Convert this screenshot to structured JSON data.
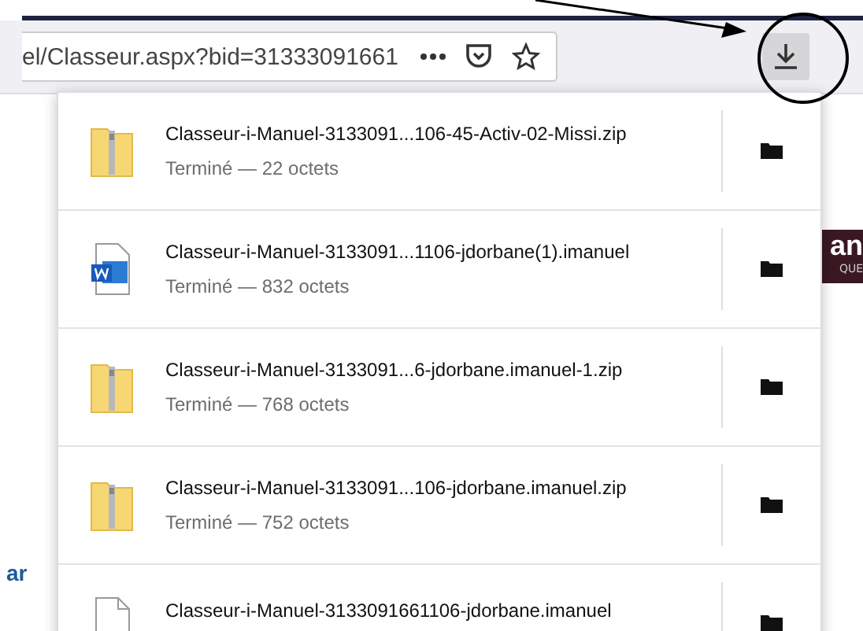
{
  "toolbar": {
    "url": "el/Classeur.aspx?bid=31333091661"
  },
  "page": {
    "logo_text": "an",
    "logo_subtext": "QUE",
    "link_text": "ar"
  },
  "downloads": [
    {
      "kind": "zip",
      "name": "Classeur-i-Manuel-3133091...106-45-Activ-02-Missi.zip",
      "status": "Terminé — 22 octets"
    },
    {
      "kind": "word",
      "name": "Classeur-i-Manuel-3133091...1106-jdorbane(1).imanuel",
      "status": "Terminé — 832 octets"
    },
    {
      "kind": "zip",
      "name": "Classeur-i-Manuel-3133091...6-jdorbane.imanuel-1.zip",
      "status": "Terminé — 768 octets"
    },
    {
      "kind": "zip",
      "name": "Classeur-i-Manuel-3133091...106-jdorbane.imanuel.zip",
      "status": "Terminé — 752 octets"
    },
    {
      "kind": "file",
      "name": "Classeur-i-Manuel-3133091661106-jdorbane.imanuel"
    }
  ]
}
